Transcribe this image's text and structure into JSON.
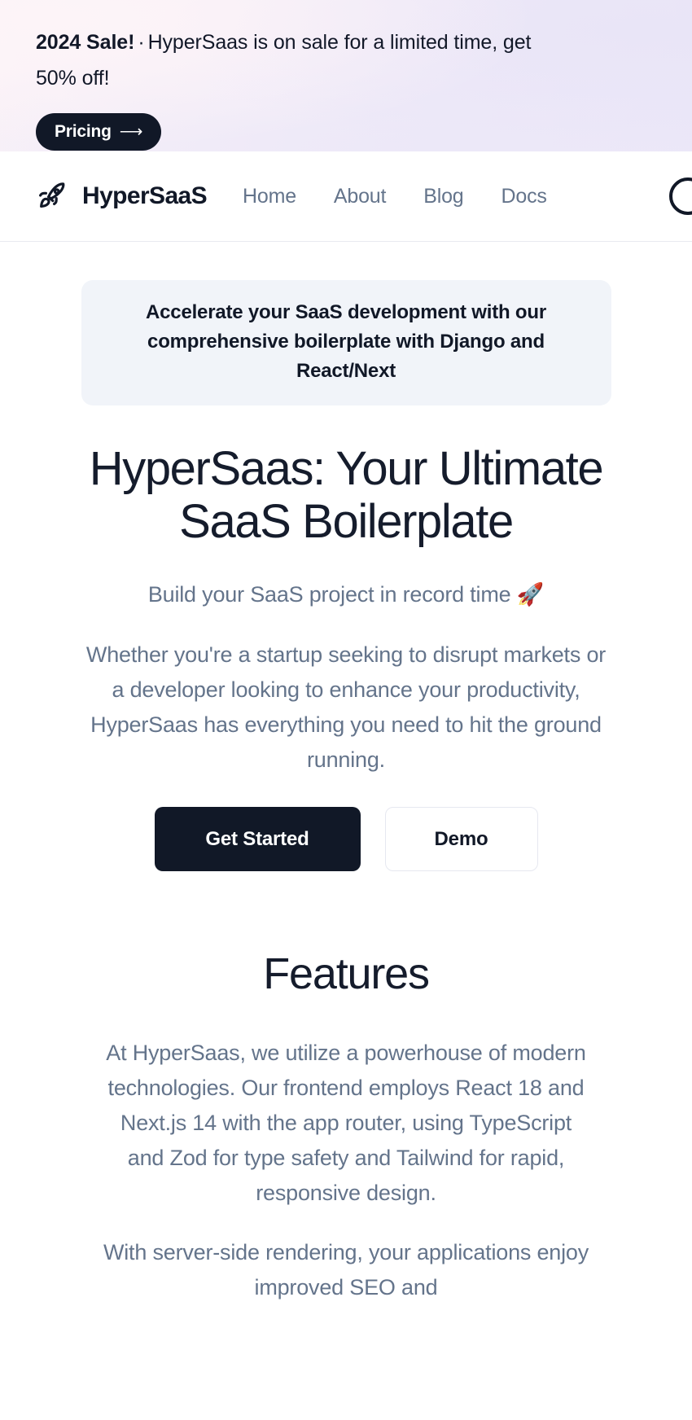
{
  "announcement": {
    "lead": "2024 Sale!",
    "separator": "·",
    "message": "HyperSaas is on sale for a limited time, get 50% off!",
    "cta_label": "Pricing",
    "cta_arrow": "⟶",
    "gradient_start": "#fbf3f7",
    "gradient_end": "#eae5f7",
    "cta_bg": "#111827"
  },
  "nav": {
    "logo_icon": "rocket-icon",
    "brand": "HyperSaaS",
    "links": [
      {
        "label": "Home",
        "name": "home"
      },
      {
        "label": "About",
        "name": "about"
      },
      {
        "label": "Blog",
        "name": "blog"
      },
      {
        "label": "Docs",
        "name": "docs"
      }
    ],
    "avatar_icon": "avatar-icon"
  },
  "hero": {
    "badge": "Accelerate your SaaS development with our comprehensive boilerplate with Django and React/Next",
    "badge_bg": "#f1f4f9",
    "title": "HyperSaas: Your Ultimate SaaS Boilerplate",
    "subtitle": "Build your SaaS project in record time 🚀",
    "description": "Whether you're a startup seeking to disrupt markets or a developer looking to enhance your productivity, HyperSaas has everything you need to hit the ground running.",
    "primary_cta": "Get Started",
    "secondary_cta": "Demo"
  },
  "features": {
    "title": "Features",
    "paragraphs": [
      "At HyperSaas, we utilize a powerhouse of modern technologies. Our frontend employs React 18 and Next.js 14 with the app router, using TypeScript and Zod for type safety and Tailwind for rapid, responsive design.",
      "With server-side rendering, your applications enjoy improved SEO and"
    ]
  },
  "theme": {
    "ink": "#111827",
    "muted": "#64748b",
    "page_bg": "#ffffff",
    "border": "#e9eaf0"
  }
}
